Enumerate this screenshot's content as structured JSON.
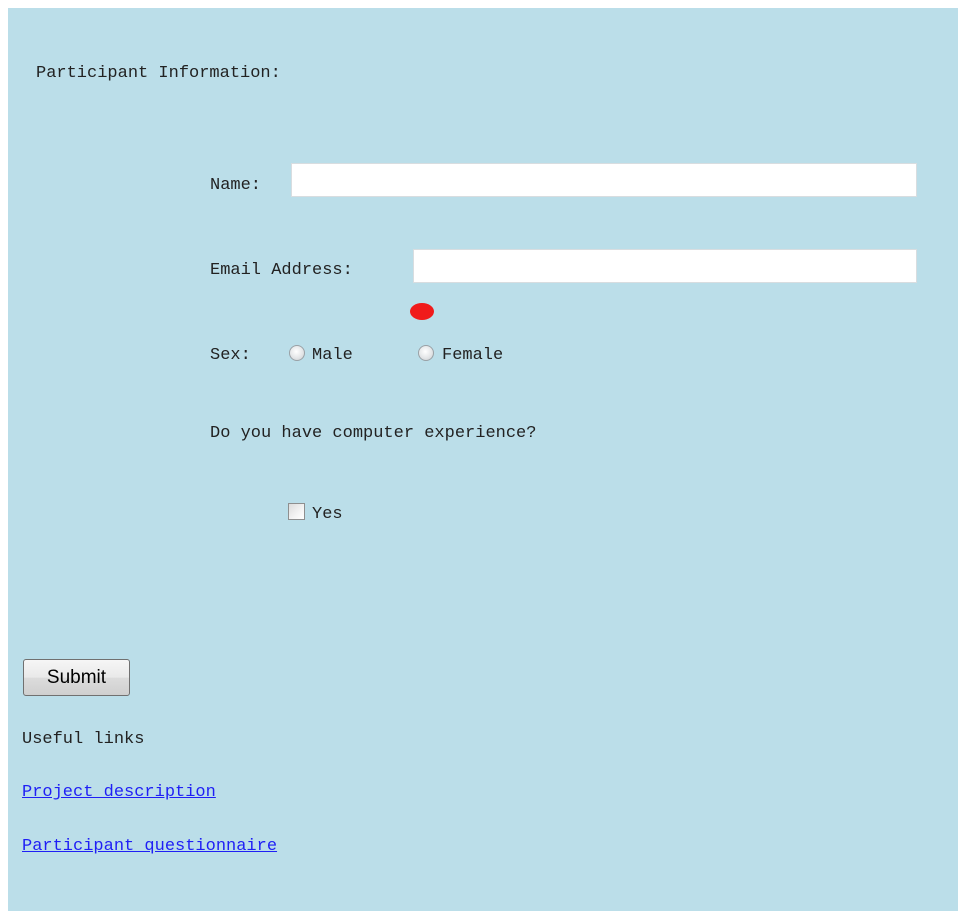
{
  "form": {
    "section_title": "Participant Information:",
    "name_label": "Name:",
    "name_value": "",
    "email_label": "Email Address:",
    "email_value": "",
    "sex_label": "Sex:",
    "sex_options": [
      "Male",
      "Female"
    ],
    "experience_question": "Do you have computer experience?",
    "experience_option": "Yes",
    "submit_label": "Submit"
  },
  "links": {
    "heading": "Useful links",
    "items": [
      "Project description",
      "Participant questionnaire"
    ]
  },
  "colors": {
    "background": "#bbdee9",
    "link": "#1f1ff5",
    "marker": "#f01b1b"
  }
}
